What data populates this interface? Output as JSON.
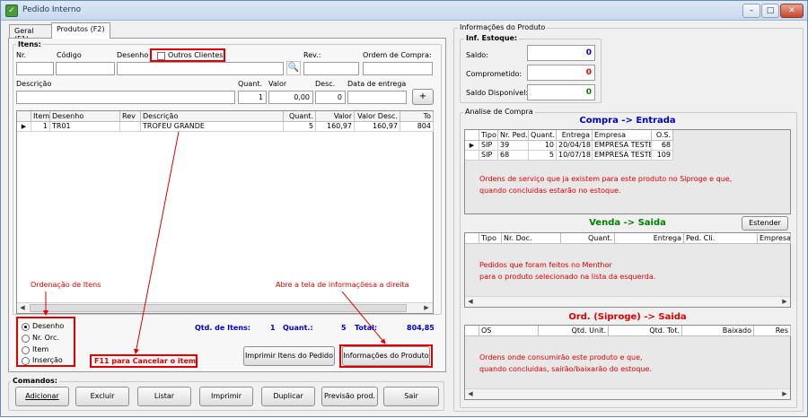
{
  "window": {
    "title": "Pedido Interno",
    "min": "–",
    "max": "□",
    "close": "✕"
  },
  "tabs": [
    "Geral (F1)",
    "Produtos (F2)"
  ],
  "itens": {
    "group": "Itens:",
    "nr": "Nr.",
    "codigo": "Código",
    "desenho": "Desenho",
    "outros": "Outros Clientes",
    "rev": "Rev.:",
    "ordem": "Ordem de Compra:",
    "descricao": "Descrição",
    "quant": "Quant.",
    "valor": "Valor",
    "desc": "Desc.",
    "data_entrega": "Data de entrega",
    "quant_val": "1",
    "valor_val": "0,00",
    "desc_val": "0",
    "add": "+"
  },
  "grid": {
    "headers": [
      "Item",
      "Desenho",
      "Rev",
      "Descrição",
      "Quant.",
      "Valor",
      "Valor Desc.",
      "To"
    ],
    "rows": [
      [
        "1",
        "TR01",
        "",
        "TROFEU GRANDE",
        "5",
        "160,97",
        "160,97",
        "804"
      ]
    ]
  },
  "annotations": {
    "ordenacao": "Ordenação de Itens",
    "abre": "Abre a tela de informaçõesa a direita",
    "f11": "F11 para Cancelar o item"
  },
  "ordenacao": [
    "Desenho",
    "Nr. Orc.",
    "Item",
    "Inserção"
  ],
  "totais": {
    "qtd_label": "Qtd. de Itens:",
    "qtd": "1",
    "quant_label": "Quant.:",
    "quant": "5",
    "total_label": "Total:",
    "total": "804,85"
  },
  "buttons": {
    "imprimir_itens": "Imprimir Itens do Pedido",
    "info_produto": "Informações do Produto"
  },
  "comandos": {
    "label": "Comandos:",
    "items": [
      "Adicionar",
      "Excluir",
      "Listar",
      "Imprimir",
      "Duplicar",
      "Previsão prod.",
      "Sair"
    ]
  },
  "info": {
    "title": "Informações do Produto",
    "estoque": "Inf. Estoque:",
    "saldo": "Saldo:",
    "saldo_val": "0",
    "comprometido": "Comprometido:",
    "comprometido_val": "0",
    "disponivel": "Saldo Disponível:",
    "disponivel_val": "0",
    "analise": "Analise de Compra",
    "compra_title": "Compra -> Entrada",
    "compra_headers": [
      "Tipo",
      "Nr. Ped.",
      "Quant.",
      "Entrega",
      "Empresa",
      "O.S."
    ],
    "compra_rows": [
      [
        "SIP",
        "39",
        "10",
        "20/04/18",
        "EMPRESA TESTE",
        "68"
      ],
      [
        "SIP",
        "68",
        "5",
        "10/07/18",
        "EMPRESA TESTE",
        "109"
      ]
    ],
    "compra_note1": "Ordens de serviço que ja existem para este produto no Siproge e que,",
    "compra_note2": "quando concluidas estarão no estoque.",
    "venda_title": "Venda -> Saida",
    "estender": "Estender",
    "venda_headers": [
      "Tipo",
      "Nr. Doc.",
      "Quant.",
      "Entrega",
      "Ped. Cli.",
      "Empresa"
    ],
    "venda_note1": "Pedidos que foram feitos no Menthor",
    "venda_note2": "para o produto selecionado na lista da esquerda.",
    "ord_title": "Ord. (Siproge) -> Saida",
    "ord_headers": [
      "OS",
      "Qtd. Unit.",
      "Qtd. Tot.",
      "Baixado",
      "Res"
    ],
    "ord_note1": "Ordens onde consumirão este produto e que,",
    "ord_note2": "quando concluidas, sairão/baixarão do estoque.",
    "colors": {
      "blue": "#0000cc",
      "red": "#e00000",
      "green": "#008000",
      "title": "#1e395b"
    }
  }
}
